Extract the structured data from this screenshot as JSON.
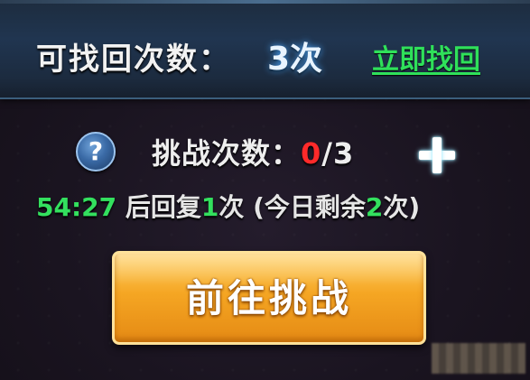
{
  "recover": {
    "label": "可找回次数：",
    "count": "3次",
    "link": "立即找回"
  },
  "challenge": {
    "help_symbol": "?",
    "label": "挑战次数：",
    "used": "0",
    "total": "/3"
  },
  "timer": {
    "time": "54:27",
    "text1": " 后回复",
    "restore_count": "1",
    "text2": "次 (今日剩余",
    "remaining": "2",
    "text3": "次)"
  },
  "go_button": {
    "label": "前往挑战"
  },
  "icons": {
    "help": "question-icon",
    "add": "plus-icon"
  },
  "colors": {
    "accent_green": "#33e05e",
    "used_red": "#ff2a2a",
    "button_orange": "#f5a623"
  }
}
